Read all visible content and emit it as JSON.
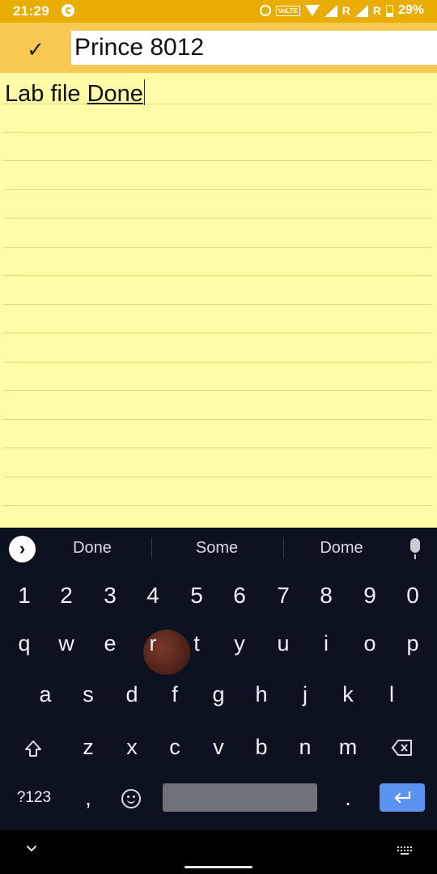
{
  "status_bar": {
    "time": "21:29",
    "volte_label": "VoLTE",
    "sim1_label": "R",
    "sim2_label": "R",
    "battery": "29%"
  },
  "title_bar": {
    "title_value": "Prince 8012",
    "confirm_icon": "check-icon"
  },
  "note": {
    "text_plain": "Lab file ",
    "text_underlined": "Done"
  },
  "keyboard": {
    "suggestions": [
      "Done",
      "Some",
      "Dome"
    ],
    "number_row": [
      "1",
      "2",
      "3",
      "4",
      "5",
      "6",
      "7",
      "8",
      "9",
      "0"
    ],
    "row1": [
      "q",
      "w",
      "e",
      "r",
      "t",
      "y",
      "u",
      "i",
      "o",
      "p"
    ],
    "row2": [
      "a",
      "s",
      "d",
      "f",
      "g",
      "h",
      "j",
      "k",
      "l"
    ],
    "row3": [
      "z",
      "x",
      "c",
      "v",
      "b",
      "n",
      "m"
    ],
    "symbols_label": "?123",
    "comma": ",",
    "period": "."
  },
  "colors": {
    "status_bar": "#e9ac00",
    "title_bar": "#f7c952",
    "note_background": "#fffca8",
    "keyboard_background": "#0d1220",
    "enter_key": "#5b93f0"
  }
}
